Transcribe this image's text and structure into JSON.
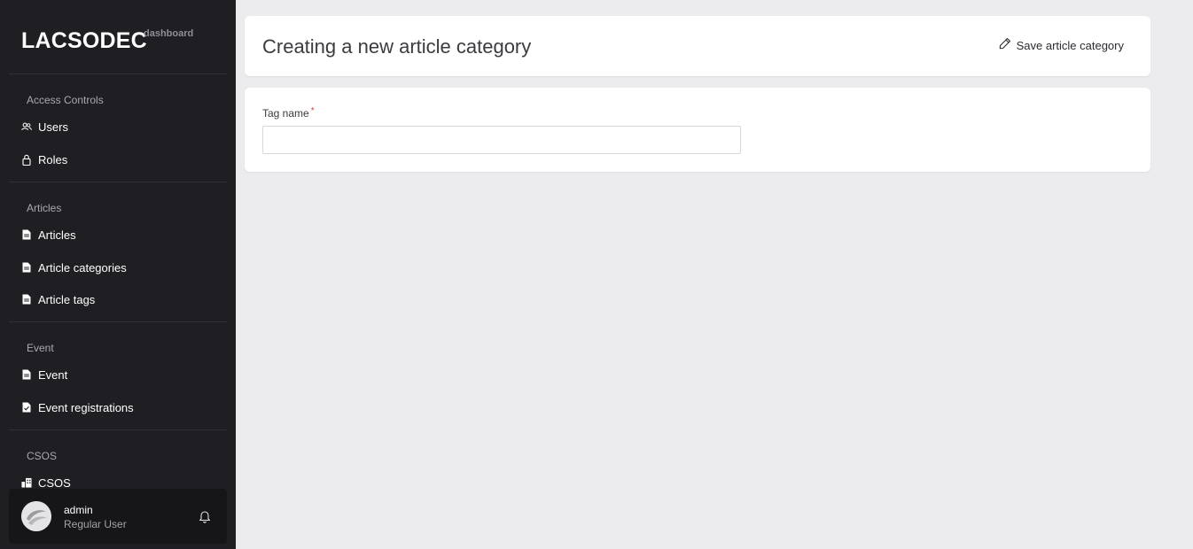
{
  "brand": {
    "name": "LACSODEC",
    "sub": "dashboard"
  },
  "sidebar": {
    "sections": [
      {
        "title": "Access Controls",
        "items": [
          {
            "label": "Users",
            "icon": "users-icon"
          },
          {
            "label": "Roles",
            "icon": "lock-icon"
          }
        ]
      },
      {
        "title": "Articles",
        "items": [
          {
            "label": "Articles",
            "icon": "document-icon"
          },
          {
            "label": "Article categories",
            "icon": "document-icon"
          },
          {
            "label": "Article tags",
            "icon": "document-icon"
          }
        ]
      },
      {
        "title": "Event",
        "items": [
          {
            "label": "Event",
            "icon": "document-icon"
          },
          {
            "label": "Event registrations",
            "icon": "document-check-icon"
          }
        ]
      },
      {
        "title": "CSOS",
        "items": [
          {
            "label": "CSOS",
            "icon": "buildings-icon"
          }
        ]
      }
    ]
  },
  "user": {
    "name": "admin",
    "role": "Regular User"
  },
  "header": {
    "title": "Creating a new article category",
    "save_label": "Save article category"
  },
  "form": {
    "tag_label": "Tag name",
    "required_mark": "*",
    "tag_value": ""
  },
  "colors": {
    "sidebar_bg": "#1f1f23",
    "page_bg": "#ececee",
    "required": "#d23b3b"
  }
}
